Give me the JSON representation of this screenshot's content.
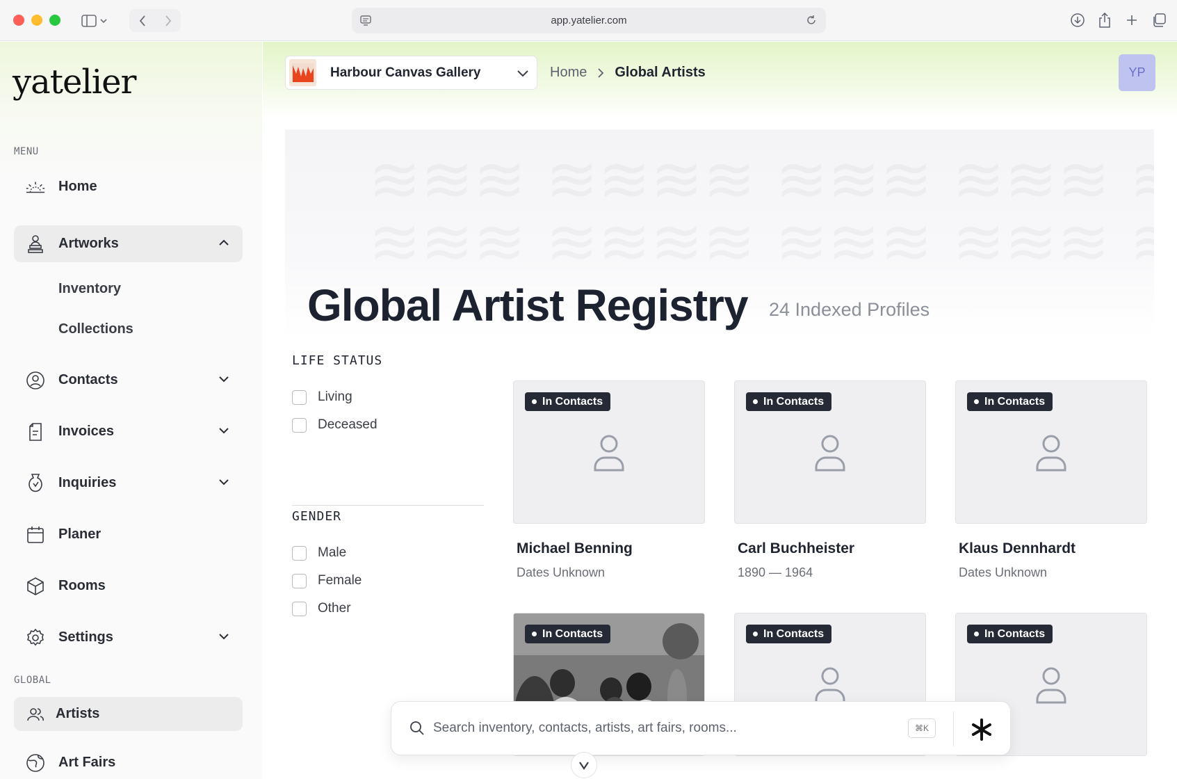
{
  "browser": {
    "url": "app.yatelier.com"
  },
  "sidebar": {
    "logo": "yatelier",
    "menu_label": "MENU",
    "global_label": "GLOBAL",
    "items": [
      {
        "label": "Home",
        "icon": "sunrise-icon"
      },
      {
        "label": "Artworks",
        "icon": "bust-icon",
        "expanded": true
      },
      {
        "label": "Contacts",
        "icon": "user-circle-icon"
      },
      {
        "label": "Invoices",
        "icon": "document-icon"
      },
      {
        "label": "Inquiries",
        "icon": "vase-icon"
      },
      {
        "label": "Planer",
        "icon": "calendar-icon"
      },
      {
        "label": "Rooms",
        "icon": "cube-icon"
      },
      {
        "label": "Settings",
        "icon": "gear-icon"
      }
    ],
    "artworks_sub": [
      "Inventory",
      "Collections"
    ],
    "global_items": [
      {
        "label": "Artists",
        "icon": "users-icon",
        "active": true
      },
      {
        "label": "Art Fairs",
        "icon": "globe-icon"
      }
    ]
  },
  "header": {
    "gallery": "Harbour Canvas Gallery",
    "breadcrumb": [
      "Home",
      "Global Artists"
    ],
    "avatar_initials": "YP"
  },
  "page": {
    "title": "Global Artist Registry",
    "count": "24 Indexed Profiles"
  },
  "filters": {
    "life_status": {
      "title": "LIFE STATUS",
      "options": [
        "Living",
        "Deceased"
      ]
    },
    "gender": {
      "title": "GENDER",
      "options": [
        "Male",
        "Female",
        "Other"
      ]
    }
  },
  "artists": [
    {
      "name": "Michael Benning",
      "dates": "Dates Unknown",
      "badge": "In Contacts"
    },
    {
      "name": "Carl Buchheister",
      "dates": "1890 — 1964",
      "badge": "In Contacts"
    },
    {
      "name": "Klaus Dennhardt",
      "dates": "Dates Unknown",
      "badge": "In Contacts"
    },
    {
      "name": "",
      "dates": "",
      "badge": "In Contacts",
      "photo": true
    },
    {
      "name": "",
      "dates": "",
      "badge": "In Contacts"
    },
    {
      "name": "",
      "dates": "",
      "badge": "In Contacts"
    }
  ],
  "search": {
    "placeholder": "Search inventory, contacts, artists, art fairs, rooms...",
    "shortcut": "⌘K"
  }
}
